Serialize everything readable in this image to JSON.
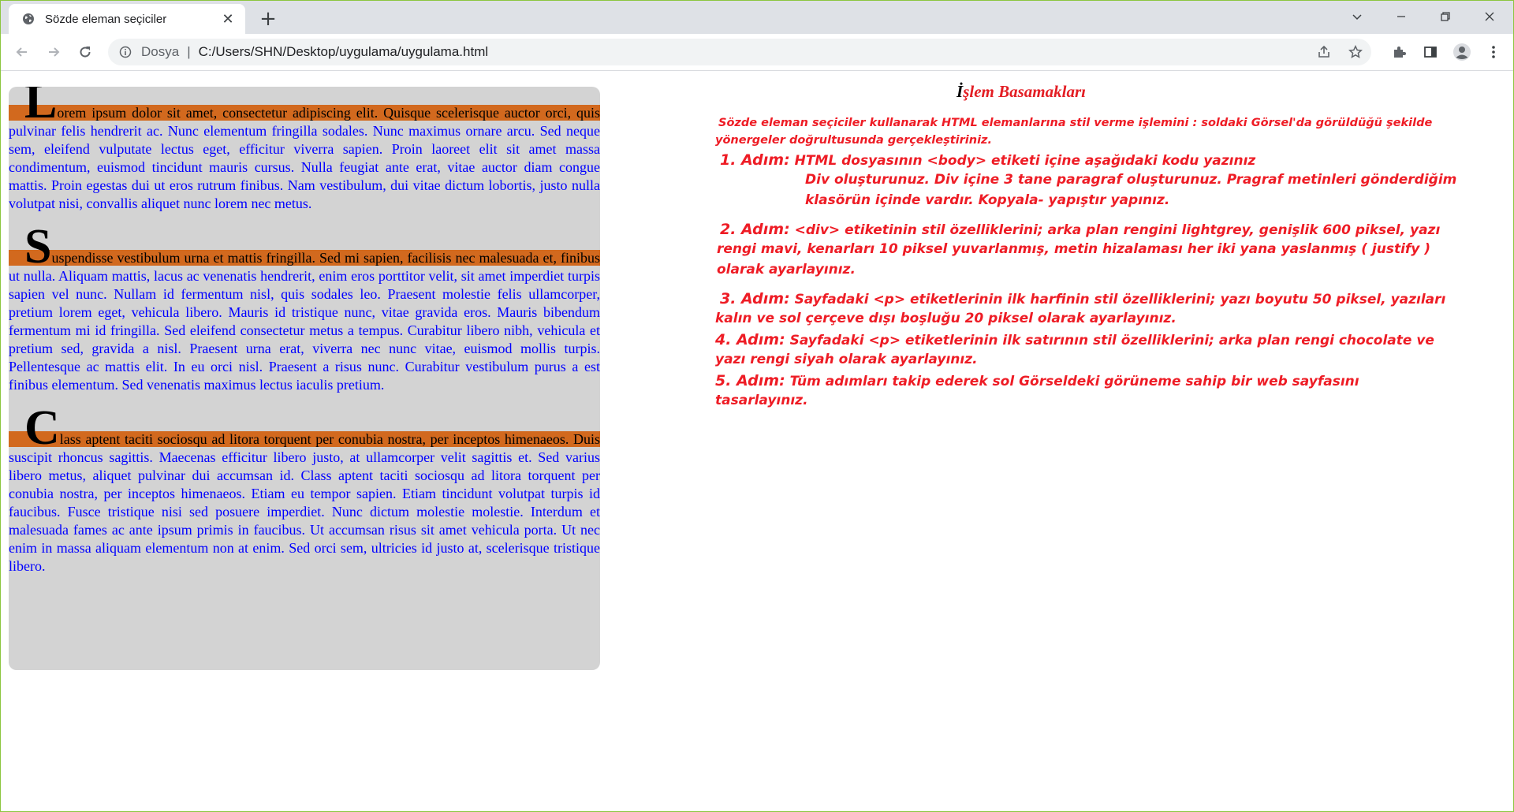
{
  "browser": {
    "tab_title": "Sözde eleman seçiciler",
    "new_tab": "+",
    "close_tab": "✕",
    "omnibox_scheme": "Dosya",
    "omnibox_separator": "|",
    "omnibox_url": "C:/Users/SHN/Desktop/uygulama/uygulama.html"
  },
  "icons": {
    "favicon": "globe-icon",
    "back": "arrow-left-icon",
    "forward": "arrow-right-icon",
    "reload": "reload-icon",
    "info": "info-icon",
    "share": "share-icon",
    "bookmark": "star-icon",
    "extensions": "puzzle-icon",
    "side_panel": "side-panel-icon",
    "profile": "profile-icon",
    "menu": "kebab-menu-icon",
    "tab_search": "chevron-down-icon",
    "minimize": "minimize-icon",
    "restore": "restore-icon",
    "close": "close-icon"
  },
  "colors": {
    "box_background": "#d3d3d3",
    "first_line_background": "#d2691e",
    "paragraph_text": "#0000ff",
    "instruction_text": "#ee1c25"
  },
  "content": {
    "paragraphs": [
      "Lorem ipsum dolor sit amet, consectetur adipiscing elit. Quisque scelerisque auctor orci, quis pulvinar felis hendrerit ac. Nunc elementum fringilla sodales. Nunc maximus ornare arcu. Sed neque sem, eleifend vulputate lectus eget, efficitur viverra sapien. Proin laoreet elit sit amet massa condimentum, euismod tincidunt mauris cursus. Nulla feugiat ante erat, vitae auctor diam congue mattis. Proin egestas dui ut eros rutrum finibus. Nam vestibulum, dui vitae dictum lobortis, justo nulla volutpat nisi, convallis aliquet nunc lorem nec metus.",
      "Suspendisse vestibulum urna et mattis fringilla. Sed mi sapien, facilisis nec malesuada et, finibus ut nulla. Aliquam mattis, lacus ac venenatis hendrerit, enim eros porttitor velit, sit amet imperdiet turpis sapien vel nunc. Nullam id fermentum nisl, quis sodales leo. Praesent molestie felis ullamcorper, pretium lorem eget, vehicula libero. Mauris id tristique nunc, vitae gravida eros. Mauris bibendum fermentum mi id fringilla. Sed eleifend consectetur metus a tempus. Curabitur libero nibh, vehicula et pretium sed, gravida a nisl. Praesent urna erat, viverra nec nunc vitae, euismod mollis turpis. Pellentesque ac mattis elit. In eu orci nisl. Praesent a risus nunc. Curabitur vestibulum purus a est finibus elementum. Sed venenatis maximus lectus iaculis pretium.",
      "Class aptent taciti sociosqu ad litora torquent per conubia nostra, per inceptos himenaeos. Duis suscipit rhoncus sagittis. Maecenas efficitur libero justo, at ullamcorper velit sagittis et. Sed varius libero metus, aliquet pulvinar dui accumsan id. Class aptent taciti sociosqu ad litora torquent per conubia nostra, per inceptos himenaeos. Etiam eu tempor sapien. Etiam tincidunt volutpat turpis id faucibus. Fusce tristique nisi sed posuere imperdiet. Nunc dictum molestie molestie. Interdum et malesuada fames ac ante ipsum primis in faucibus. Ut accumsan risus sit amet vehicula porta. Ut nec enim in massa aliquam elementum non at enim. Sed orci sem, ultricies id justo at, scelerisque tristique libero."
    ]
  },
  "instructions": {
    "title_first": "İ",
    "title_rest": "şlem Basamakları",
    "intro_line1": "Sözde eleman seçiciler kullanarak HTML elemanlarına stil verme işlemini : soldaki Görsel'da görüldüğü şekilde",
    "intro_line2": "yönergeler doğrultusunda gerçekleştiriniz.",
    "step1_label": "1. Adım:",
    "step1_text": "HTML dosyasının <body> etiketi içine aşağıdaki kodu yazınız",
    "step1_sub1": "Div oluşturunuz. Div içine 3 tane paragraf oluşturunuz. Pragraf metinleri gönderdiğim",
    "step1_sub2": "klasörün içinde vardır. Kopyala- yapıştır yapınız.",
    "step2_label": "2. Adım:",
    "step2_text": "<div> etiketinin stil özelliklerini; arka plan rengini lightgrey, genişlik 600 piksel, yazı",
    "step2_line2": "rengi mavi, kenarları 10 piksel yuvarlanmış, metin hizalaması her iki yana yaslanmış ( justify )",
    "step2_line3": "olarak ayarlayınız.",
    "step3_label": "3. Adım:",
    "step3_text": "Sayfadaki <p> etiketlerinin ilk harfinin stil özelliklerini; yazı boyutu 50 piksel, yazıları",
    "step3_line2": "kalın ve sol çerçeve dışı boşluğu 20 piksel olarak ayarlayınız.",
    "step4_label": "4. Adım:",
    "step4_text": "Sayfadaki <p> etiketlerinin ilk satırının stil özelliklerini; arka plan rengi chocolate ve",
    "step4_line2": "yazı rengi siyah olarak ayarlayınız.",
    "step5_label": "5. Adım:",
    "step5_text": "Tüm adımları takip ederek sol Görseldeki görüneme sahip bir web sayfasını",
    "step5_line2": "tasarlayınız."
  }
}
